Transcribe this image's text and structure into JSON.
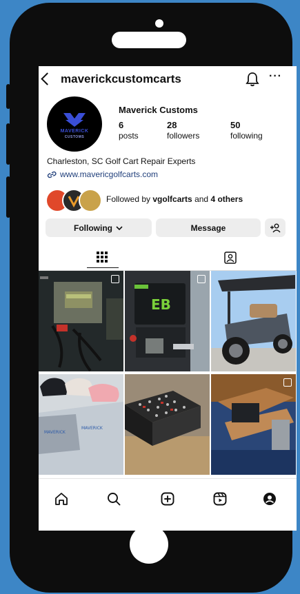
{
  "profile": {
    "username": "maverickcustomcarts",
    "display_name": "Maverick Customs",
    "avatar_text": "MAVERICK",
    "avatar_subtext": "CUSTOMS",
    "bio": "Charleston, SC Golf Cart Repair Experts",
    "website": "www.mavericgolfcarts.com"
  },
  "stats": {
    "posts_value": "6",
    "posts_label": "posts",
    "followers_value": "28",
    "followers_label": "followers",
    "following_value": "50",
    "following_label": "following"
  },
  "followed_by": {
    "prefix": "Followed by",
    "name": "vgolfcarts",
    "middle": "and",
    "others": "4 others"
  },
  "buttons": {
    "following_label": "Following",
    "message_label": "Message"
  },
  "icons": {
    "back": "chevron-left-icon",
    "notifications": "bell-icon",
    "more": "more-horizontal-icon",
    "suggest": "add-person-icon",
    "grid_tab": "grid-icon",
    "tagged_tab": "tagged-person-icon",
    "nav": [
      "home-icon",
      "search-icon",
      "create-post-icon",
      "reels-icon",
      "profile-icon"
    ]
  },
  "colors": {
    "phone_body": "#0d0d0d",
    "background": "#3d86c6",
    "link": "#1f3e7a",
    "button_bg": "#ededed"
  }
}
